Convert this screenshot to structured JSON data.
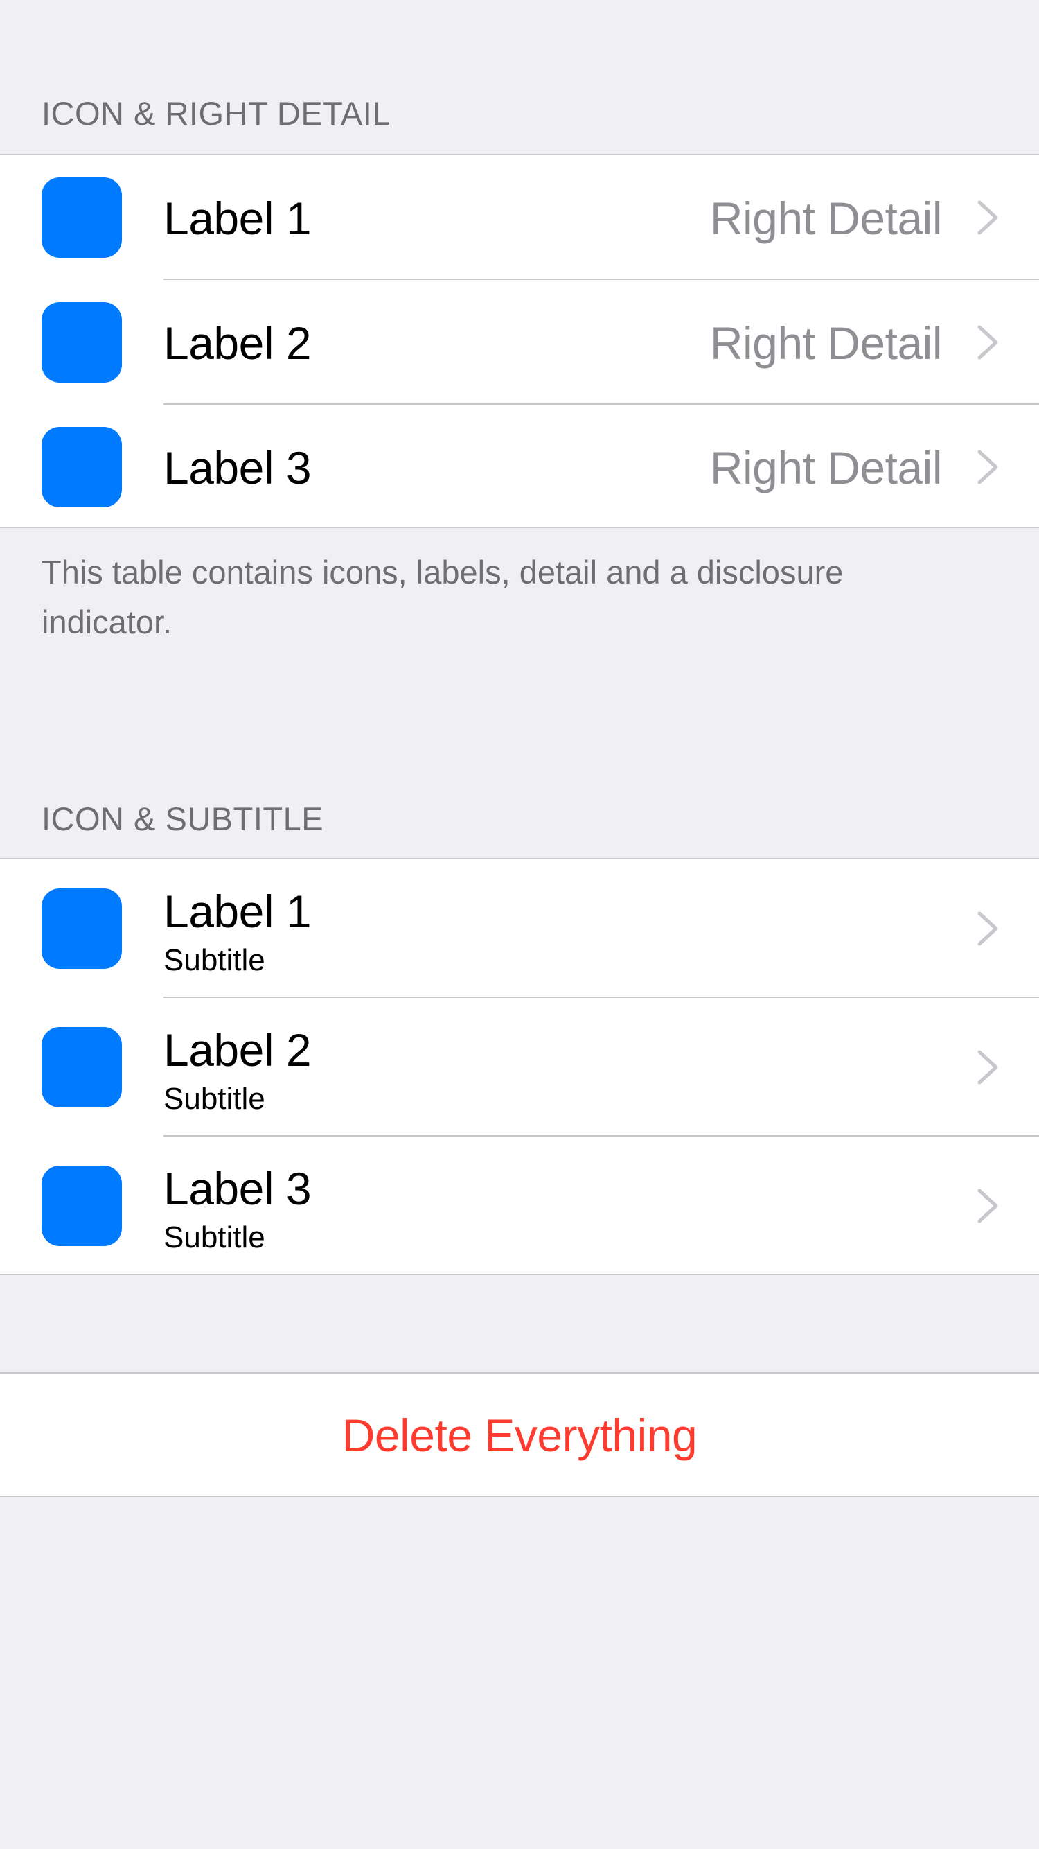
{
  "section1": {
    "header": "ICON & RIGHT DETAIL",
    "rows": [
      {
        "label": "Label 1",
        "detail": "Right Detail"
      },
      {
        "label": "Label 2",
        "detail": "Right Detail"
      },
      {
        "label": "Label 3",
        "detail": "Right Detail"
      }
    ],
    "footer": "This table contains icons, labels, detail and a disclosure indicator."
  },
  "section2": {
    "header": "ICON & SUBTITLE",
    "rows": [
      {
        "label": "Label 1",
        "subtitle": "Subtitle"
      },
      {
        "label": "Label 2",
        "subtitle": "Subtitle"
      },
      {
        "label": "Label 3",
        "subtitle": "Subtitle"
      }
    ]
  },
  "action": {
    "label": "Delete Everything"
  },
  "icons": {
    "row_icon": "blue-rounded-square-icon",
    "disclosure": "chevron-right-icon"
  },
  "colors": {
    "background": "#efeff4",
    "icon": "#007aff",
    "destructive": "#ff3b30",
    "detail": "#8e8e93",
    "header": "#6d6d72",
    "separator": "#c8c7cc",
    "chevron": "#c7c7cc"
  }
}
